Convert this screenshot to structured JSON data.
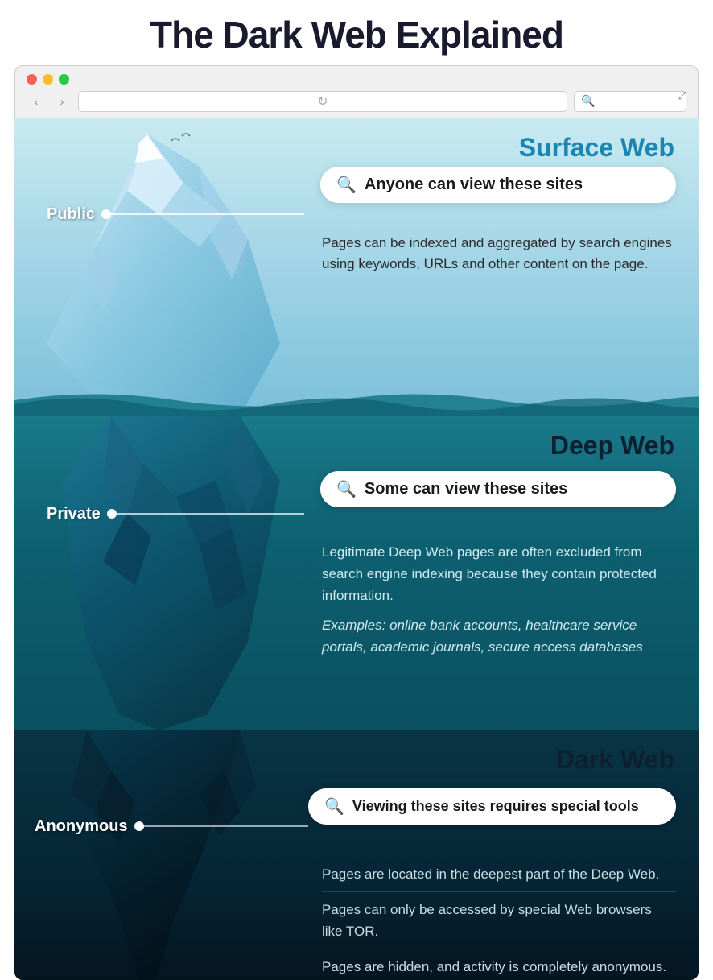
{
  "title": {
    "part1": "The Dark Web",
    "part2": "Explained"
  },
  "browser": {
    "nav_back": "‹",
    "nav_forward": "›",
    "refresh": "↻",
    "search_icon": "🔍"
  },
  "surface": {
    "label": "Surface Web",
    "search_text": "Anyone can view these sites",
    "description": "Pages can be indexed and aggregated by search engines using keywords, URLs and other content on the page.",
    "access_label": "Public"
  },
  "deep": {
    "label": "Deep Web",
    "search_text": "Some can view these sites",
    "description": "Legitimate Deep Web pages are often excluded from search engine indexing because they contain protected information.",
    "examples": "Examples: online bank accounts, healthcare service portals, academic journals, secure access databases",
    "access_label": "Private"
  },
  "dark": {
    "label": "Dark Web",
    "search_text": "Viewing these sites requires special tools",
    "desc1": "Pages are located in the deepest part of the Deep Web.",
    "desc2": "Pages can only be accessed by special Web browsers like TOR.",
    "desc3": "Pages are hidden, and activity is completely anonymous.",
    "access_label": "Anonymous"
  }
}
